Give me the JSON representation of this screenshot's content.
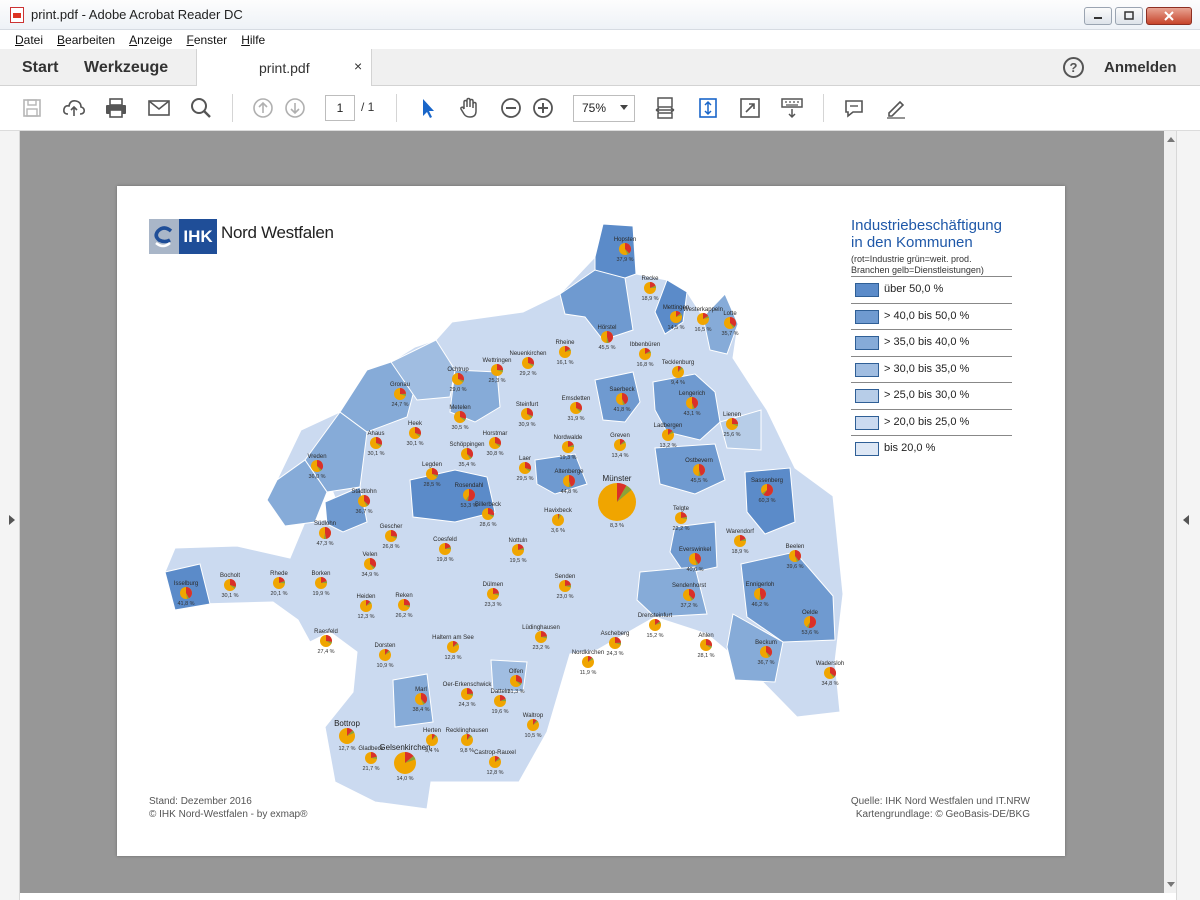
{
  "window": {
    "title": "print.pdf - Adobe Acrobat Reader DC",
    "min": "▭",
    "max": "▢",
    "close": "✕"
  },
  "menu": [
    "Datei",
    "Bearbeiten",
    "Anzeige",
    "Fenster",
    "Hilfe"
  ],
  "tabs": {
    "start": "Start",
    "tools": "Werkzeuge",
    "doc": "print.pdf",
    "close": "×",
    "help": "?",
    "signin": "Anmelden"
  },
  "toolbar": {
    "page_current": "1",
    "page_total": "/ 1",
    "zoom": "75%"
  },
  "document": {
    "logo": {
      "ihk": "IHK",
      "name": "Nord Westfalen"
    },
    "legend": {
      "title_line1": "Industriebeschäftigung",
      "title_line2": "in den Kommunen",
      "subtitle_line1": "(rot=Industrie grün=weit. prod.",
      "subtitle_line2": "Branchen gelb=Dienstleistungen)",
      "items": [
        {
          "label": "über 50,0 %",
          "color": "#5b8bc9"
        },
        {
          "label": "> 40,0 bis 50,0 %",
          "color": "#6f9ad0"
        },
        {
          "label": "> 35,0 bis 40,0 %",
          "color": "#86abd8"
        },
        {
          "label": "> 30,0 bis 35,0 %",
          "color": "#a0bde1"
        },
        {
          "label": "> 25,0 bis 30,0 %",
          "color": "#b7cde8"
        },
        {
          "label": "> 20,0 bis 25,0 %",
          "color": "#cbdaf0"
        },
        {
          "label": "bis 20,0 %",
          "color": "#dde7f5"
        }
      ]
    },
    "footer": {
      "left_line1": "Stand: Dezember 2016",
      "left_line2": "© IHK Nord-Westfalen - by exmap®",
      "right_line1": "Quelle: IHK Nord Westfalen und IT.NRW",
      "right_line2": "Kartengrundlage: © GeoBasis-DE/BKG"
    },
    "map": {
      "colors": {
        "pie_red": "#d9302a",
        "pie_green": "#8aa33a",
        "pie_yellow": "#f0a500"
      },
      "places": [
        {
          "name": "Hopsten",
          "value": "37,9 %"
        },
        {
          "name": "Recke",
          "value": "18,9 %"
        },
        {
          "name": "Mettingen",
          "value": "14,5 %"
        },
        {
          "name": "Westerkappeln",
          "value": "16,5 %"
        },
        {
          "name": "Lotte",
          "value": "35,7 %"
        },
        {
          "name": "Hörstel",
          "value": "45,5 %"
        },
        {
          "name": "Ibbenbüren",
          "value": "16,8 %"
        },
        {
          "name": "Rheine",
          "value": "16,1 %"
        },
        {
          "name": "Neuenkirchen",
          "value": "29,2 %"
        },
        {
          "name": "Wettringen",
          "value": "25,3 %"
        },
        {
          "name": "Ochtrup",
          "value": "29,0 %"
        },
        {
          "name": "Gronau",
          "value": "24,7 %"
        },
        {
          "name": "Tecklenburg",
          "value": "9,4 %"
        },
        {
          "name": "Emsdetten",
          "value": "31,9 %"
        },
        {
          "name": "Saerbeck",
          "value": "41,8 %"
        },
        {
          "name": "Steinfurt",
          "value": "30,9 %"
        },
        {
          "name": "Metelen",
          "value": "30,5 %"
        },
        {
          "name": "Heek",
          "value": "30,1 %"
        },
        {
          "name": "Ahaus",
          "value": "30,1 %"
        },
        {
          "name": "Lengerich",
          "value": "43,1 %"
        },
        {
          "name": "Lienen",
          "value": "25,6 %"
        },
        {
          "name": "Ladbergen",
          "value": "13,2 %"
        },
        {
          "name": "Greven",
          "value": "13,4 %"
        },
        {
          "name": "Nordwalde",
          "value": "19,3 %"
        },
        {
          "name": "Horstmar",
          "value": "30,8 %"
        },
        {
          "name": "Schöppingen",
          "value": "35,4 %"
        },
        {
          "name": "Vreden",
          "value": "36,0 %"
        },
        {
          "name": "Legden",
          "value": "28,5 %"
        },
        {
          "name": "Laer",
          "value": "29,5 %"
        },
        {
          "name": "Altenberge",
          "value": "44,8 %"
        },
        {
          "name": "Ostbevern",
          "value": "45,5 %"
        },
        {
          "name": "Sassenberg",
          "value": "60,3 %"
        },
        {
          "name": "Stadtlohn",
          "value": "36,7 %"
        },
        {
          "name": "Rosendahl",
          "value": "53,3 %"
        },
        {
          "name": "Billerbeck",
          "value": "28,6 %"
        },
        {
          "name": "Havixbeck",
          "value": "3,6 %"
        },
        {
          "name": "Münster",
          "value": "8,3 %"
        },
        {
          "name": "Telgte",
          "value": "22,2 %"
        },
        {
          "name": "Warendorf",
          "value": "18,9 %"
        },
        {
          "name": "Beelen",
          "value": "39,6 %"
        },
        {
          "name": "Südlohn",
          "value": "47,3 %"
        },
        {
          "name": "Gescher",
          "value": "26,8 %"
        },
        {
          "name": "Coesfeld",
          "value": "19,8 %"
        },
        {
          "name": "Nottuln",
          "value": "19,5 %"
        },
        {
          "name": "Everswinkel",
          "value": "40,6 %"
        },
        {
          "name": "Velen",
          "value": "34,9 %"
        },
        {
          "name": "Isselburg",
          "value": "41,8 %"
        },
        {
          "name": "Bocholt",
          "value": "30,1 %"
        },
        {
          "name": "Rhede",
          "value": "20,1 %"
        },
        {
          "name": "Borken",
          "value": "19,9 %"
        },
        {
          "name": "Heiden",
          "value": "12,3 %"
        },
        {
          "name": "Reken",
          "value": "26,2 %"
        },
        {
          "name": "Dülmen",
          "value": "23,3 %"
        },
        {
          "name": "Senden",
          "value": "23,0 %"
        },
        {
          "name": "Sendenhorst",
          "value": "37,2 %"
        },
        {
          "name": "Ennigerloh",
          "value": "46,2 %"
        },
        {
          "name": "Oelde",
          "value": "53,6 %"
        },
        {
          "name": "Drensteinfurt",
          "value": "15,2 %"
        },
        {
          "name": "Raesfeld",
          "value": "27,4 %"
        },
        {
          "name": "Lüdinghausen",
          "value": "23,2 %"
        },
        {
          "name": "Ascheberg",
          "value": "24,3 %"
        },
        {
          "name": "Ahlen",
          "value": "28,1 %"
        },
        {
          "name": "Beckum",
          "value": "36,7 %"
        },
        {
          "name": "Wadersloh",
          "value": "34,8 %"
        },
        {
          "name": "Dorsten",
          "value": "10,9 %"
        },
        {
          "name": "Haltern am See",
          "value": "12,8 %"
        },
        {
          "name": "Nordkirchen",
          "value": "11,9 %"
        },
        {
          "name": "Olfen",
          "value": "31,3 %"
        },
        {
          "name": "Marl",
          "value": "38,4 %"
        },
        {
          "name": "Oer-Erkenschwick",
          "value": "24,3 %"
        },
        {
          "name": "Datteln",
          "value": "19,6 %"
        },
        {
          "name": "Waltrop",
          "value": "10,5 %"
        },
        {
          "name": "Bottrop",
          "value": "12,7 %"
        },
        {
          "name": "Gladbeck",
          "value": "21,7 %"
        },
        {
          "name": "Gelsenkirchen",
          "value": "14,0 %"
        },
        {
          "name": "Herten",
          "value": "9,4 %"
        },
        {
          "name": "Recklinghausen",
          "value": "9,8 %"
        },
        {
          "name": "Castrop-Rauxel",
          "value": "12,8 %"
        }
      ]
    }
  }
}
